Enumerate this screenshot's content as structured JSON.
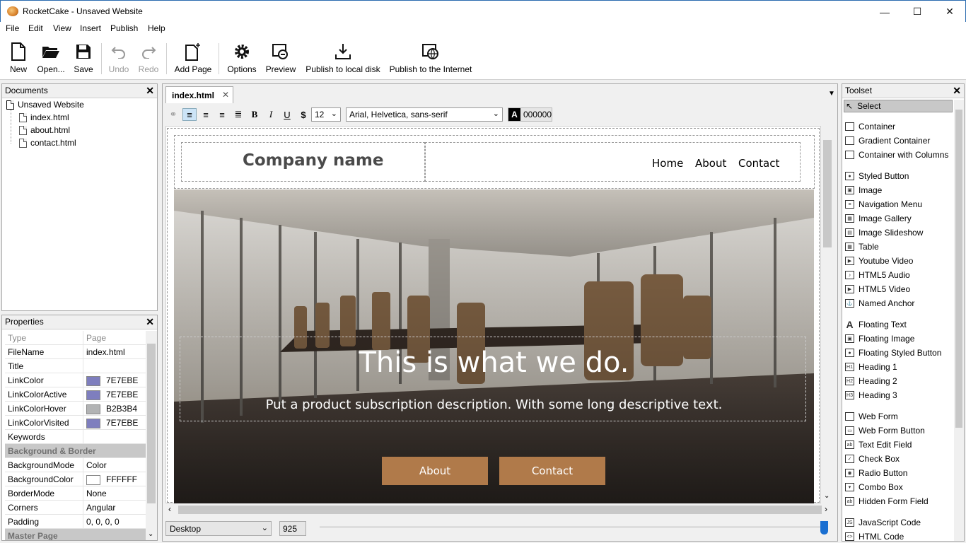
{
  "window": {
    "title": "RocketCake - Unsaved Website",
    "minimize": "—",
    "maximize": "☐",
    "close": "✕"
  },
  "menu": [
    "File",
    "Edit",
    "View",
    "Insert",
    "Publish",
    "Help"
  ],
  "toolbar": {
    "new": "New",
    "open": "Open...",
    "save": "Save",
    "undo": "Undo",
    "redo": "Redo",
    "add_page": "Add Page",
    "options": "Options",
    "preview": "Preview",
    "publish_local": "Publish to local disk",
    "publish_internet": "Publish to the Internet"
  },
  "documents": {
    "title": "Documents",
    "root": "Unsaved Website",
    "files": [
      "index.html",
      "about.html",
      "contact.html"
    ]
  },
  "properties": {
    "title": "Properties",
    "header": {
      "key": "Type",
      "value": "Page"
    },
    "rows": [
      {
        "key": "FileName",
        "value": "index.html"
      },
      {
        "key": "Title",
        "value": ""
      },
      {
        "key": "LinkColor",
        "value": "7E7EBE",
        "color": "#7e7ebe"
      },
      {
        "key": "LinkColorActive",
        "value": "7E7EBE",
        "color": "#7e7ebe"
      },
      {
        "key": "LinkColorHover",
        "value": "B2B3B4",
        "color": "#b2b3b4"
      },
      {
        "key": "LinkColorVisited",
        "value": "7E7EBE",
        "color": "#7e7ebe"
      },
      {
        "key": "Keywords",
        "value": ""
      }
    ],
    "section_bg": "Background & Border",
    "rows2": [
      {
        "key": "BackgroundMode",
        "value": "Color"
      },
      {
        "key": "BackgroundColor",
        "value": "FFFFFF",
        "color": "#ffffff"
      },
      {
        "key": "BorderMode",
        "value": "None"
      },
      {
        "key": "Corners",
        "value": "Angular"
      },
      {
        "key": "Padding",
        "value": "0, 0, 0, 0"
      }
    ],
    "section_master": "Master Page"
  },
  "editor": {
    "tab": "index.html",
    "font_size": "12",
    "font_family": "Arial, Helvetica, sans-serif",
    "text_color": "000000",
    "text_color_label": "A"
  },
  "site": {
    "company": "Company name",
    "nav": [
      "Home",
      "About",
      "Contact"
    ],
    "headline": "This is what we do.",
    "subtitle": "Put a product subscription description. With some long descriptive text.",
    "btn_about": "About",
    "btn_contact": "Contact",
    "accent": "#b07a4a"
  },
  "statusbar": {
    "device": "Desktop",
    "width": "925"
  },
  "toolset": {
    "title": "Toolset",
    "select": "Select",
    "groups": [
      [
        "Container",
        "Gradient Container",
        "Container with Columns"
      ],
      [
        "Styled Button",
        "Image",
        "Navigation Menu",
        "Image Gallery",
        "Image Slideshow",
        "Table",
        "Youtube Video",
        "HTML5 Audio",
        "HTML5 Video",
        "Named Anchor"
      ],
      [
        "Floating Text",
        "Floating Image",
        "Floating Styled Button",
        "Heading 1",
        "Heading 2",
        "Heading 3"
      ],
      [
        "Web Form",
        "Web Form Button",
        "Text Edit Field",
        "Check Box",
        "Radio Button",
        "Combo Box",
        "Hidden Form Field"
      ],
      [
        "JavaScript Code",
        "HTML Code"
      ]
    ],
    "icons": [
      [
        "container-icon",
        "gradient-container-icon",
        "columns-icon"
      ],
      [
        "styled-button-icon",
        "image-icon",
        "navigation-menu-icon",
        "image-gallery-icon",
        "image-slideshow-icon",
        "table-icon",
        "youtube-icon",
        "audio-icon",
        "video-icon",
        "anchor-icon"
      ],
      [
        "text-icon",
        "floating-image-icon",
        "floating-button-icon",
        "h1-icon",
        "h2-icon",
        "h3-icon"
      ],
      [
        "web-form-icon",
        "form-button-icon",
        "text-field-icon",
        "checkbox-icon",
        "radio-icon",
        "combo-icon",
        "hidden-field-icon"
      ],
      [
        "javascript-icon",
        "html-code-icon"
      ]
    ]
  }
}
